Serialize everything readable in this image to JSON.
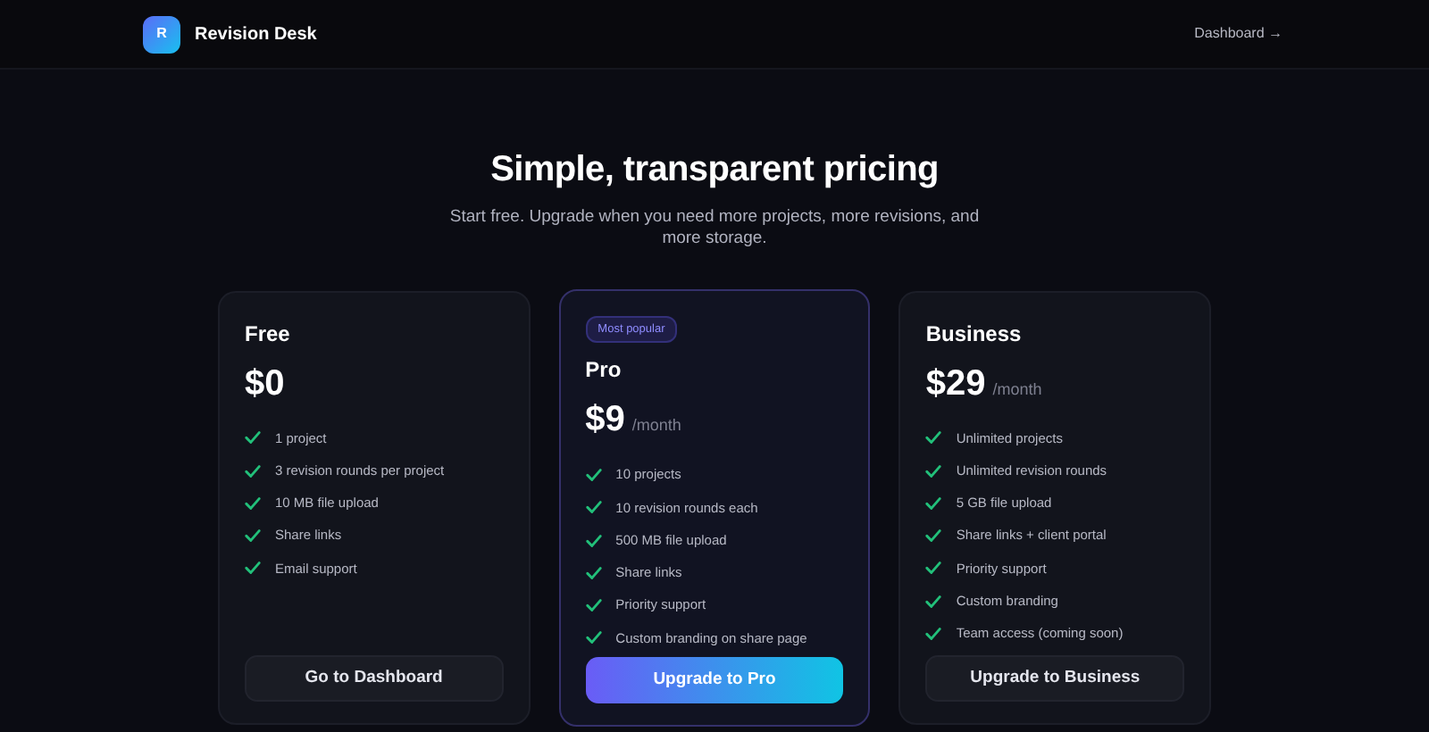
{
  "header": {
    "logo_letter": "R",
    "brand": "Revision Desk",
    "nav_link": "Dashboard →"
  },
  "hero": {
    "title": "Simple, transparent pricing",
    "subtitle": "Start free. Upgrade when you need more projects, more revisions, and more storage."
  },
  "plans": [
    {
      "name": "Free",
      "price": "$0",
      "featured": false,
      "features": [
        "1 project",
        "3 revision rounds per project",
        "10 MB file upload",
        "Share links",
        "Email support"
      ],
      "button": "Go to Dashboard"
    },
    {
      "name": "Pro",
      "badge": "Most popular",
      "price": "$9",
      "period": "/month",
      "featured": true,
      "features": [
        "10 projects",
        "10 revision rounds each",
        "500 MB file upload",
        "Share links",
        "Priority support",
        "Custom branding on share page"
      ],
      "button": "Upgrade to Pro"
    },
    {
      "name": "Business",
      "price": "$29",
      "period": "/month",
      "featured": false,
      "features": [
        "Unlimited projects",
        "Unlimited revision rounds",
        "5 GB file upload",
        "Share links + client portal",
        "Priority support",
        "Custom branding",
        "Team access (coming soon)"
      ],
      "button": "Upgrade to Business"
    }
  ]
}
